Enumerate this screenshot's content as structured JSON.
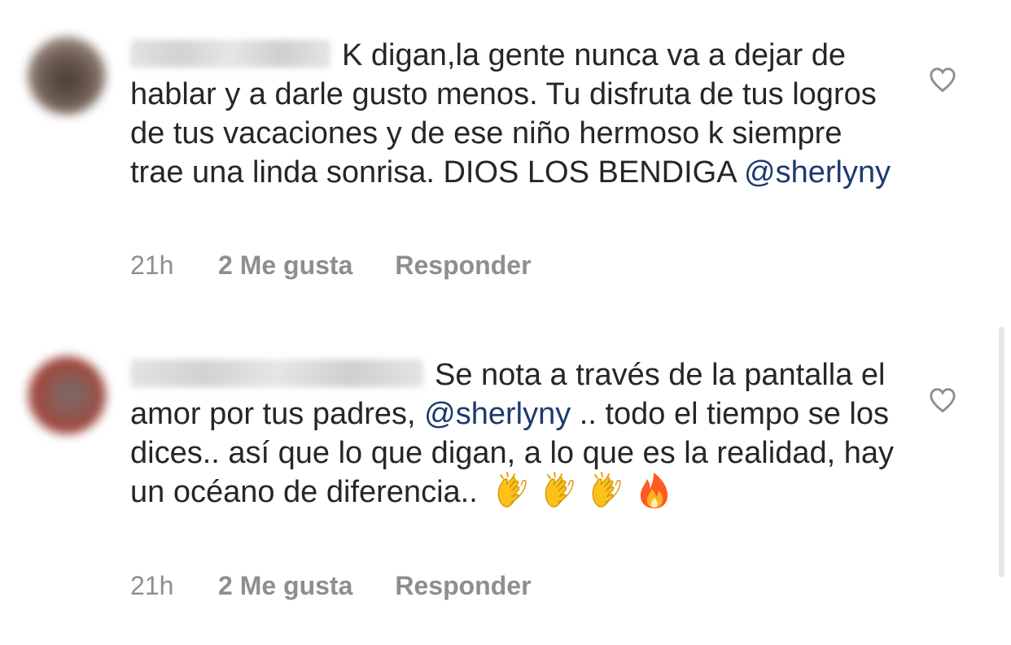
{
  "comments": [
    {
      "text_before": "K digan,la gente nunca va a dejar de hablar y a darle gusto menos. Tu disfruta de tus logros de tus vacaciones y de ese niño hermoso k siempre trae una linda sonrisa. DIOS LOS BENDIGA ",
      "mention": "@sherlyny",
      "text_after": "",
      "time": "21h",
      "likes": "2 Me gusta",
      "reply_label": "Responder",
      "like_icon": "heart-outline-icon"
    },
    {
      "text_before": "Se nota a través de la pantalla el amor por tus padres, ",
      "mention": "@sherlyny",
      "text_after": " .. todo el tiempo se los dices.. así que lo que digan, a lo que es la realidad, hay un océano de diferencia.. ",
      "emojis": [
        "clapping-hands-icon",
        "clapping-hands-icon",
        "clapping-hands-icon",
        "fire-icon"
      ],
      "time": "21h",
      "likes": "2 Me gusta",
      "reply_label": "Responder",
      "like_icon": "heart-outline-icon"
    }
  ],
  "colors": {
    "text": "#262626",
    "meta": "#8e8e8e",
    "mention": "#1c3a6e"
  }
}
